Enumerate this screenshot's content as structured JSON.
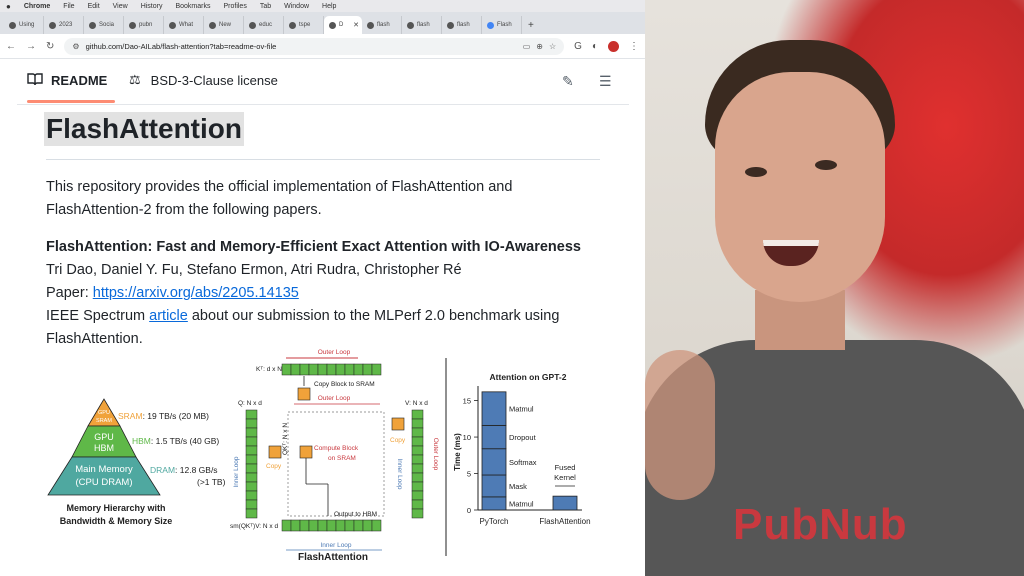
{
  "menubar": {
    "apple": "",
    "items": [
      "Chrome",
      "File",
      "Edit",
      "View",
      "History",
      "Bookmarks",
      "Profiles",
      "Tab",
      "Window",
      "Help"
    ]
  },
  "tabs": [
    {
      "label": "Using",
      "icon": "page-icon"
    },
    {
      "label": "2023",
      "icon": "page-icon"
    },
    {
      "label": "Socia",
      "icon": "page-icon"
    },
    {
      "label": "pubn",
      "icon": "page-icon"
    },
    {
      "label": "What",
      "icon": "page-icon"
    },
    {
      "label": "New",
      "icon": "page-icon"
    },
    {
      "label": "educ",
      "icon": "page-icon"
    },
    {
      "label": "tspe",
      "icon": "github-icon"
    },
    {
      "label": "D",
      "icon": "github-icon",
      "active": true
    },
    {
      "label": "flash",
      "icon": "github-icon"
    },
    {
      "label": "flash",
      "icon": "github-icon"
    },
    {
      "label": "flash",
      "icon": "github-icon"
    },
    {
      "label": "Flash",
      "icon": "google-icon"
    }
  ],
  "toolbar": {
    "url": "github.com/Dao-AILab/flash-attention?tab=readme-ov-file"
  },
  "readme": {
    "tab_label": "README",
    "license_label": "BSD-3-Clause license",
    "title": "FlashAttention",
    "intro": "This repository provides the official implementation of FlashAttention and FlashAttention-2 from the following papers.",
    "paper_title": "FlashAttention: Fast and Memory-Efficient Exact Attention with IO-Awareness",
    "authors": "Tri Dao, Daniel Y. Fu, Stefano Ermon, Atri Rudra, Christopher Ré",
    "paper_prefix": "Paper: ",
    "paper_link": "https://arxiv.org/abs/2205.14135",
    "ieee_prefix": "IEEE Spectrum ",
    "article_link": "article",
    "ieee_suffix": " about our submission to the MLPerf 2.0 benchmark using FlashAttention."
  },
  "figure": {
    "pyramid": {
      "levels": [
        {
          "name": "GPU SRAM",
          "label": "SRAM: 19 TB/s (20 MB)",
          "color": "#f0a23a"
        },
        {
          "name": "GPU HBM",
          "label": "HBM: 1.5 TB/s (40 GB)",
          "color": "#5fb848"
        },
        {
          "name": "Main Memory (CPU DRAM)",
          "label": "DRAM: 12.8 GB/s (>1 TB)",
          "color": "#4fa8a0"
        }
      ],
      "level_text": [
        [
          "GPU",
          "SRAM"
        ],
        [
          "GPU",
          "HBM"
        ],
        [
          "Main Memory",
          "(CPU DRAM)"
        ]
      ],
      "label_lines": [
        [
          "SRAM",
          ": 19 TB/s (20 MB)"
        ],
        [
          "HBM",
          ": 1.5 TB/s (40 GB)"
        ],
        [
          "DRAM",
          ": 12.8 GB/s"
        ]
      ],
      "dram_extra": "(>1 TB)",
      "caption": [
        "Memory Hierarchy with",
        "Bandwidth & Memory Size"
      ]
    },
    "flash": {
      "outer_loop": "Outer Loop",
      "kt_label": "Kᵀ: d x N",
      "copy_block_sram": "Copy Block to SRAM",
      "q_label": "Q: N x d",
      "qkt_label": "QKᵀ: N x N",
      "v_label": "V: N x d",
      "copy": "Copy",
      "inner_loop": "Inner Loop",
      "compute_block": "Compute Block",
      "on_sram": "on SRAM",
      "output_to_hbm": "Output to HBM",
      "sm_label": "sm(QKᵀ)V: N x d",
      "caption": "FlashAttention"
    },
    "chart": {
      "title": "Attention on GPT-2",
      "ylabel": "Time (ms)",
      "yticks": [
        "0",
        "5",
        "10",
        "15"
      ],
      "categories": [
        "PyTorch",
        "FlashAttention"
      ],
      "segments": [
        "Matmul",
        "Mask",
        "Softmax",
        "Dropout",
        "Matmul"
      ],
      "flash_label": [
        "Fused",
        "Kernel"
      ],
      "bar_color": "#4e7bb5"
    }
  },
  "chart_data": {
    "type": "bar",
    "title": "Attention on GPT-2",
    "xlabel": "",
    "ylabel": "Time (ms)",
    "ylim": [
      0,
      17
    ],
    "categories": [
      "PyTorch",
      "FlashAttention"
    ],
    "series": [
      {
        "name": "Matmul",
        "values": [
          1.8,
          0
        ]
      },
      {
        "name": "Mask",
        "values": [
          3.0,
          0
        ]
      },
      {
        "name": "Softmax",
        "values": [
          3.6,
          0
        ]
      },
      {
        "name": "Dropout",
        "values": [
          3.2,
          0
        ]
      },
      {
        "name": "Matmul",
        "values": [
          4.6,
          0
        ]
      },
      {
        "name": "Fused Kernel",
        "values": [
          0,
          1.9
        ]
      }
    ]
  },
  "video": {
    "shirt_logo": "PubNub"
  }
}
